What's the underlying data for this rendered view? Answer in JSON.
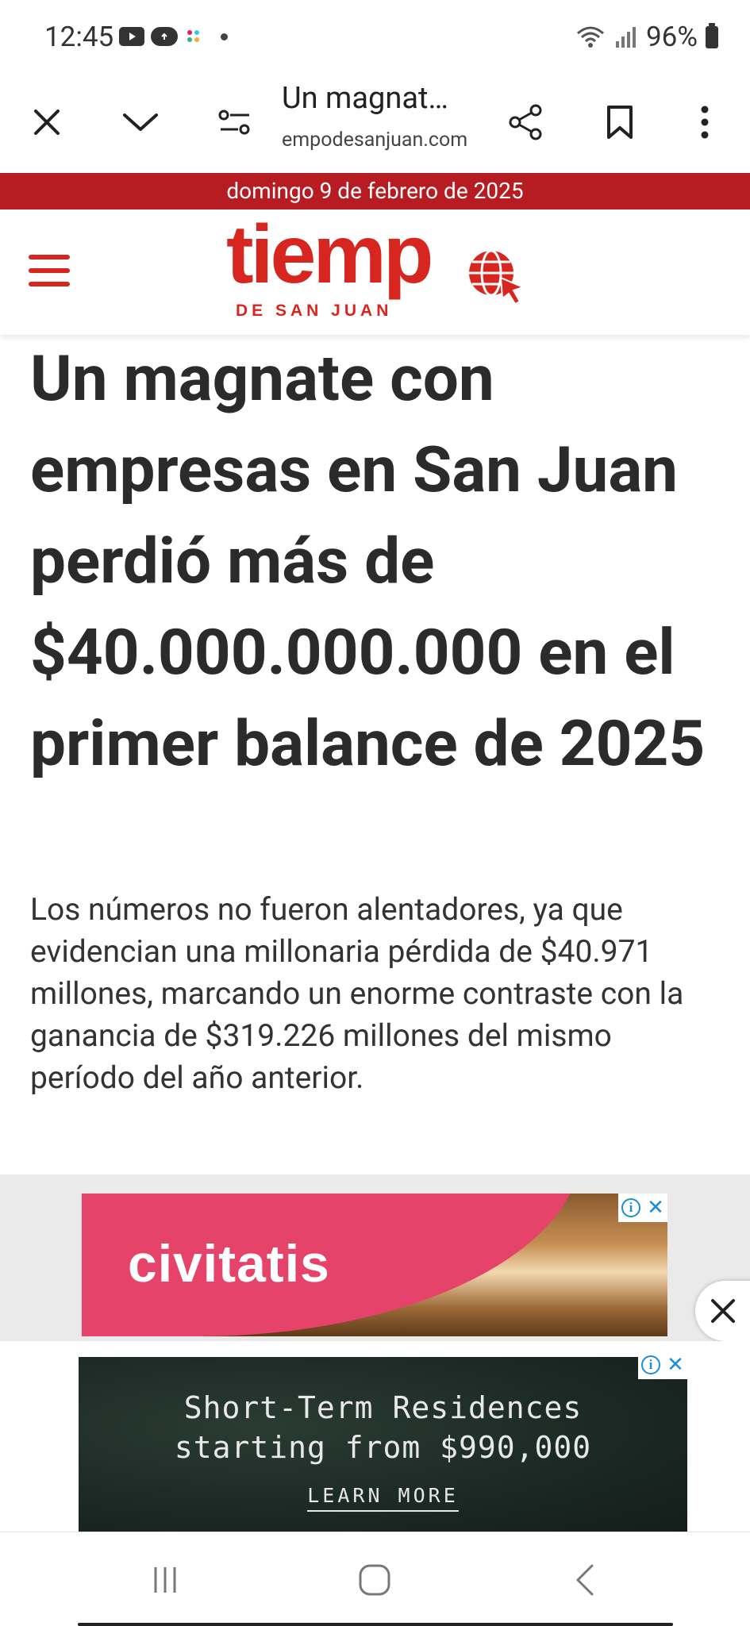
{
  "status_bar": {
    "time": "12:45",
    "battery": "96%"
  },
  "browser": {
    "tab_title": "Un magnat…",
    "url": "empodesanjuan.com"
  },
  "site": {
    "date": "domingo 9 de febrero de 2025",
    "logo_word": "tiemp",
    "logo_subtitle": "DE SAN JUAN",
    "accent_color": "#d7261f",
    "date_bar_color": "#b71c22"
  },
  "article": {
    "headline": "Un magnate con empresas en San Juan perdió más de $40.000.000.000 en el primer balance de 2025",
    "summary": "Los números no fueron alentadores, ya que evidencian una millonaria pérdida de $40.971 millones, marcando un enorme contraste con la ganancia de $319.226 millones del mismo período del año anterior."
  },
  "ads": {
    "ad1_brand": "civitatis",
    "ad2_line1": "Short-Term Residences",
    "ad2_line2": "starting from $990,000",
    "ad2_cta": "LEARN MORE",
    "info_glyph": "i",
    "close_glyph": "✕"
  }
}
